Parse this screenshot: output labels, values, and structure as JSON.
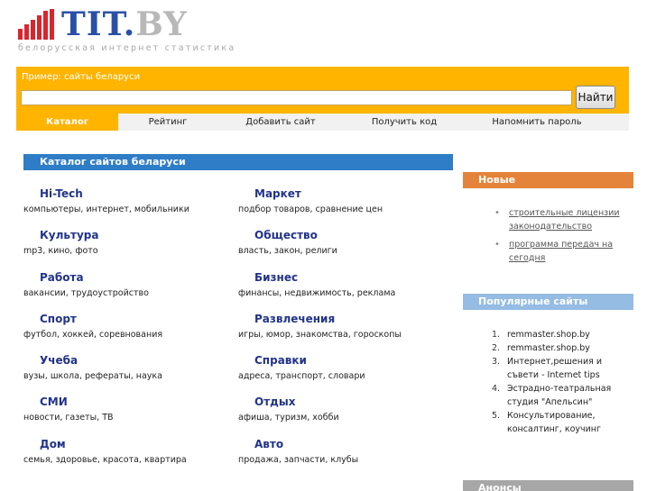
{
  "logo": {
    "name_main": "TIT",
    "name_dot": ".",
    "name_tld": "BY",
    "tagline": "белорусская интернет статистика"
  },
  "search": {
    "hint": "Пример: сайты беларуси",
    "value": "",
    "placeholder": "",
    "button_label": "Найти"
  },
  "nav": {
    "items": [
      {
        "label": "Каталог",
        "active": true
      },
      {
        "label": "Рейтинг"
      },
      {
        "label": "Добавить сайт"
      },
      {
        "label": "Получить код"
      },
      {
        "label": "Напомнить пароль"
      }
    ]
  },
  "catalog": {
    "title": "Каталог сайтов беларуси",
    "left": [
      {
        "name": "Hi-Tech",
        "sub": "компьютеры, интернет, мобильники"
      },
      {
        "name": "Культура",
        "sub": "mp3, кино, фото"
      },
      {
        "name": "Работа",
        "sub": "вакансии, трудоустройство"
      },
      {
        "name": "Спорт",
        "sub": "футбол, хоккей, соревнования"
      },
      {
        "name": "Учеба",
        "sub": "вузы, школа, рефераты, наука"
      },
      {
        "name": "СМИ",
        "sub": "новости, газеты, ТВ"
      },
      {
        "name": "Дом",
        "sub": "семья, здоровье, красота, квартира"
      }
    ],
    "right": [
      {
        "name": "Маркет",
        "sub": "подбор товаров, сравнение цен"
      },
      {
        "name": "Общество",
        "sub": "власть, закон, религи"
      },
      {
        "name": "Бизнес",
        "sub": "финансы, недвижимость, реклама"
      },
      {
        "name": "Развлечения",
        "sub": "игры, юмор, знакомства, гороскопы"
      },
      {
        "name": "Справки",
        "sub": "адреса, транспорт, словари"
      },
      {
        "name": "Отдых",
        "sub": "афиша, туризм, хобби"
      },
      {
        "name": "Авто",
        "sub": "продажа, запчасти, клубы"
      }
    ]
  },
  "sidebar": {
    "new_title": "Новые",
    "new_items": [
      "строительные лицензии законодательство",
      "программа передач на сегодня"
    ],
    "popular_title": "Популярные сайты",
    "popular_items": [
      {
        "num": "1.",
        "text": "remmaster.shop.by"
      },
      {
        "num": "2.",
        "text": "remmaster.shop.by"
      },
      {
        "num": "3.",
        "text": "Интернет,решения и съвети - Internet tips"
      },
      {
        "num": "4.",
        "text": "Эстрадно-театральная студия \"Апельсин\""
      },
      {
        "num": "5.",
        "text": "Консультирование, консалтинг, коучинг"
      }
    ],
    "announce_title": "Анонсы"
  },
  "colors": {
    "accent_orange": "#ffb400",
    "catalog_blue": "#2e7dc6",
    "link_navy": "#22338a",
    "logo_red": "#d8262e",
    "logo_blue": "#2a4fa8"
  }
}
